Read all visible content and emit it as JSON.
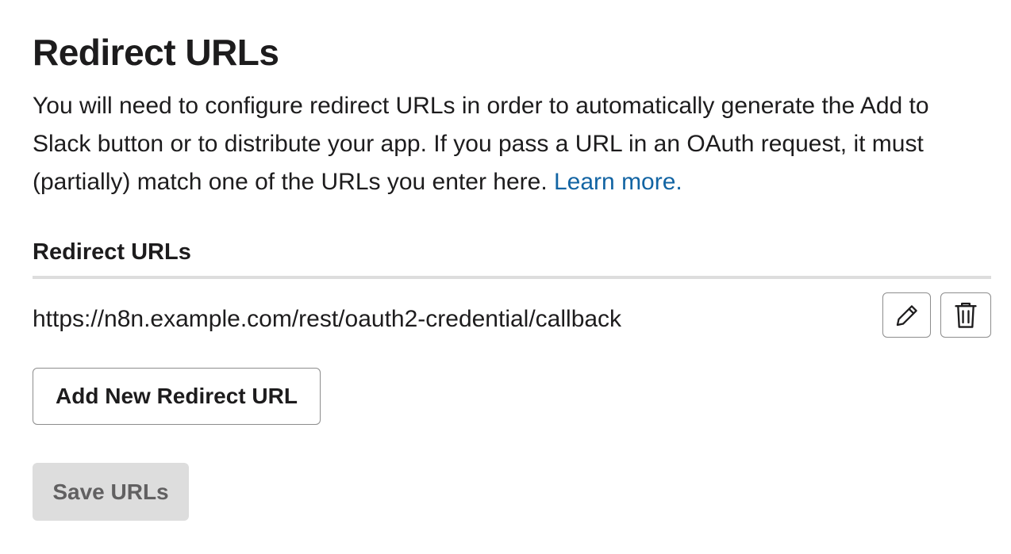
{
  "header": {
    "title": "Redirect URLs"
  },
  "description": {
    "text": "You will need to configure redirect URLs in order to automatically generate the Add to Slack button or to distribute your app. If you pass a URL in an OAuth request, it must (partially) match one of the URLs you enter here.",
    "link_label": "Learn more."
  },
  "redirect_urls": {
    "label": "Redirect URLs",
    "items": [
      {
        "url": "https://n8n.example.com/rest/oauth2-credential/callback",
        "edit_icon": "pencil-icon",
        "delete_icon": "trash-icon"
      }
    ]
  },
  "actions": {
    "add_label": "Add New Redirect URL",
    "save_label": "Save URLs"
  },
  "colors": {
    "text": "#1d1c1d",
    "link": "#1264a3",
    "divider": "#dddddd",
    "border": "#8d8d8d",
    "save_bg": "#dddddd",
    "save_text": "#616061"
  }
}
